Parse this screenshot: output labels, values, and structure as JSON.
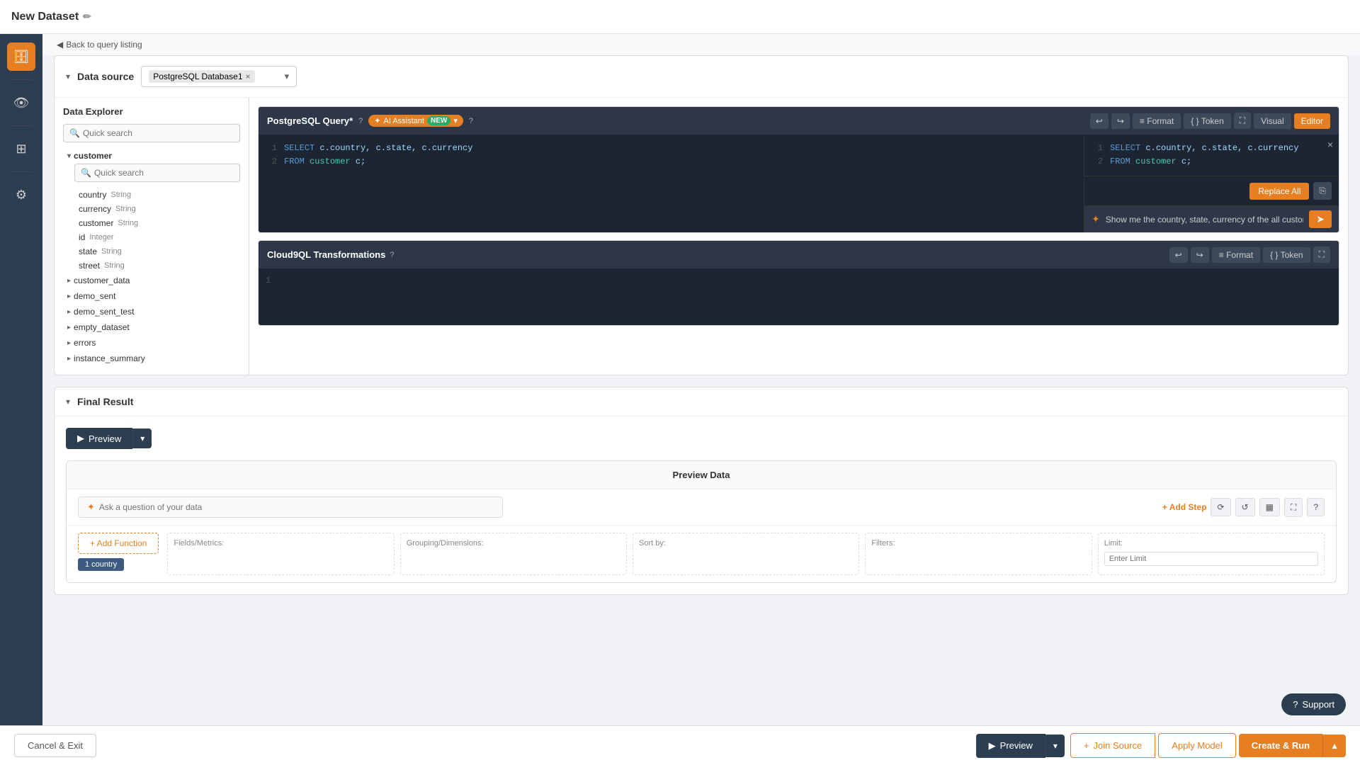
{
  "page": {
    "title": "New Dataset",
    "back_link": "Back to query listing"
  },
  "top_bar": {
    "title": "New Dataset",
    "edit_icon": "✏"
  },
  "sidebar": {
    "icons": [
      {
        "name": "database-icon",
        "symbol": "🗄",
        "active": true
      },
      {
        "name": "eye-icon",
        "symbol": "👁",
        "active": false
      },
      {
        "name": "table-icon",
        "symbol": "⊞",
        "active": false
      },
      {
        "name": "gear-icon",
        "symbol": "⚙",
        "active": false
      }
    ]
  },
  "data_source": {
    "label": "Data source",
    "selected": "PostgreSQL Database1",
    "remove_x": "×",
    "chevron": "▾"
  },
  "data_explorer": {
    "title": "Data Explorer",
    "search1_placeholder": "Quick search",
    "customer_table": {
      "name": "customer",
      "expanded": true,
      "search2_placeholder": "Quick search",
      "fields": [
        {
          "name": "country",
          "type": "String"
        },
        {
          "name": "currency",
          "type": "String"
        },
        {
          "name": "customer",
          "type": "String"
        },
        {
          "name": "id",
          "type": "Integer"
        },
        {
          "name": "state",
          "type": "String"
        },
        {
          "name": "street",
          "type": "String"
        }
      ]
    },
    "other_tables": [
      {
        "name": "customer_data",
        "expanded": false
      },
      {
        "name": "demo_sent",
        "expanded": false
      },
      {
        "name": "demo_sent_test",
        "expanded": false
      },
      {
        "name": "empty_dataset",
        "expanded": false
      },
      {
        "name": "errors",
        "expanded": false
      },
      {
        "name": "instance_summary",
        "expanded": false
      }
    ]
  },
  "postgresql_query": {
    "title": "PostgreSQL Query*",
    "help_icon": "?",
    "ai_assistant_label": "AI Assistant",
    "new_badge": "NEW",
    "dropdown_icon": "▾",
    "ai_help_icon": "?",
    "toolbar": {
      "undo_icon": "↩",
      "redo_icon": "↪",
      "format_label": "Format",
      "token_label": "Token",
      "expand_icon": "⛶",
      "visual_label": "Visual",
      "editor_label": "Editor"
    },
    "sql_lines": [
      {
        "num": "1",
        "content": "SELECT c.country, c.state, c.currency"
      },
      {
        "num": "2",
        "content": "FROM customer c;"
      }
    ],
    "ai_suggestion": {
      "close_icon": "×",
      "lines": [
        {
          "num": "1",
          "content": "SELECT c.country, c.state, c.currency"
        },
        {
          "num": "2",
          "content": "FROM customer c;"
        }
      ],
      "replace_all_label": "Replace All",
      "copy_icon": "⎘"
    },
    "ai_input": {
      "icon": "✦",
      "placeholder": "Show me the country, state, currency of the all customer",
      "send_icon": "➤"
    }
  },
  "cloud9ql": {
    "title": "Cloud9QL Transformations",
    "help_icon": "?",
    "toolbar": {
      "undo_icon": "↩",
      "redo_icon": "↪",
      "format_label": "Format",
      "token_label": "Token",
      "expand_icon": "⛶"
    },
    "line_num": "1"
  },
  "final_result": {
    "title": "Final Result",
    "collapse_icon": "▾",
    "preview_btn": "Preview",
    "chevron_icon": "▾",
    "preview_data_title": "Preview Data",
    "ai_question_placeholder": "Ask a question of your data",
    "add_step_label": "+ Add Step",
    "toolbar_icons": [
      "⟳",
      "↺",
      "▦",
      "⛶",
      "?"
    ],
    "add_function_label": "+ Add Function",
    "fields_label": "Fields/Metrics:",
    "grouping_label": "Grouping/Dimensions:",
    "sort_label": "Sort by:",
    "filters_label": "Filters:",
    "limit_label": "Limit:",
    "limit_placeholder": "Enter Limit",
    "field_tag": "1 country"
  },
  "bottom_bar": {
    "cancel_label": "Cancel & Exit",
    "preview_label": "Preview",
    "preview_play": "▶",
    "chevron_icon": "▾",
    "join_source_label": "Join Source",
    "join_plus": "+",
    "apply_model_label": "Apply Model",
    "create_run_label": "Create & Run",
    "chevron_up": "▲"
  },
  "support": {
    "icon": "?",
    "label": "Support"
  }
}
